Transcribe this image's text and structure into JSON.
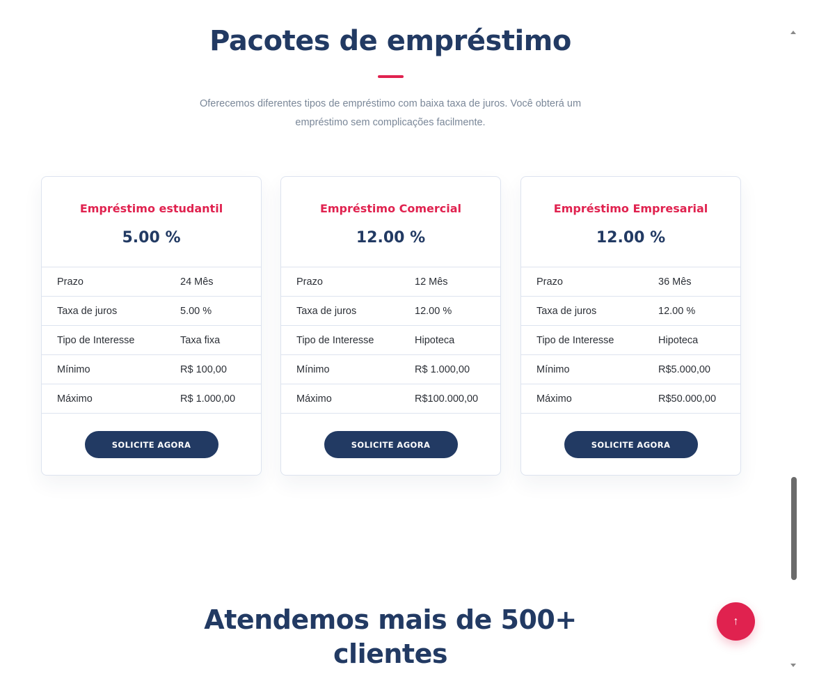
{
  "packages_section": {
    "title": "Pacotes de empréstimo",
    "description": "Oferecemos diferentes tipos de empréstimo com baixa taxa de juros. Você obterá um empréstimo sem complicações facilmente."
  },
  "loan_cards": [
    {
      "name": "Empréstimo estudantil",
      "rate": "5.00 %",
      "rows": [
        {
          "label": "Prazo",
          "value": "24 Mês"
        },
        {
          "label": "Taxa de juros",
          "value": "5.00 %"
        },
        {
          "label": "Tipo de Interesse",
          "value": "Taxa fixa"
        },
        {
          "label": "Mínimo",
          "value": "R$ 100,00"
        },
        {
          "label": "Máximo",
          "value": "R$ 1.000,00"
        }
      ],
      "button_label": "SOLICITE AGORA"
    },
    {
      "name": "Empréstimo Comercial",
      "rate": "12.00 %",
      "rows": [
        {
          "label": "Prazo",
          "value": "12 Mês"
        },
        {
          "label": "Taxa de juros",
          "value": "12.00 %"
        },
        {
          "label": "Tipo de Interesse",
          "value": "Hipoteca"
        },
        {
          "label": "Mínimo",
          "value": "R$ 1.000,00"
        },
        {
          "label": "Máximo",
          "value": "R$100.000,00"
        }
      ],
      "button_label": "SOLICITE AGORA"
    },
    {
      "name": "Empréstimo Empresarial",
      "rate": "12.00 %",
      "rows": [
        {
          "label": "Prazo",
          "value": "36 Mês"
        },
        {
          "label": "Taxa de juros",
          "value": "12.00 %"
        },
        {
          "label": "Tipo de Interesse",
          "value": "Hipoteca"
        },
        {
          "label": "Mínimo",
          "value": "R$5.000,00"
        },
        {
          "label": "Máximo",
          "value": "R$50.000,00"
        }
      ],
      "button_label": "SOLICITE AGORA"
    }
  ],
  "clients_section": {
    "title_line1": "Atendemos mais de 500+",
    "title_line2": "clientes"
  },
  "back_to_top": {
    "icon": "arrow-up-icon",
    "glyph": "↑"
  },
  "colors": {
    "brand_navy": "#223a63",
    "accent_red": "#e0224f",
    "muted_text": "#7a8798"
  }
}
